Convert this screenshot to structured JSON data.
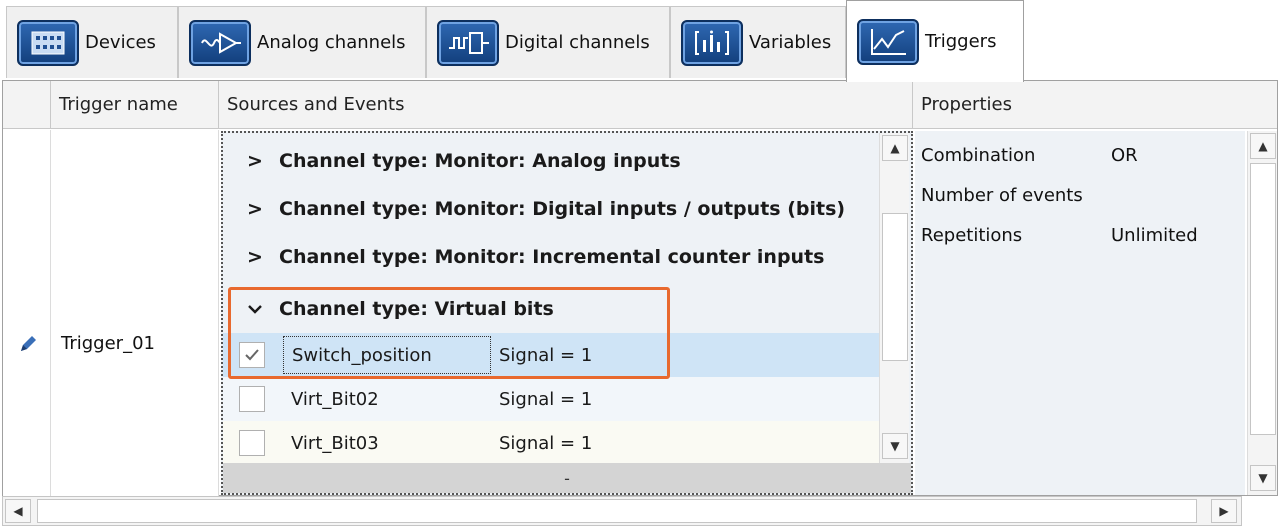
{
  "tabs": [
    {
      "label": "Devices",
      "icon": "devices-icon",
      "active": false
    },
    {
      "label": "Analog channels",
      "icon": "analog-channels-icon",
      "active": false
    },
    {
      "label": "Digital channels",
      "icon": "digital-channels-icon",
      "active": false
    },
    {
      "label": "Variables",
      "icon": "variables-icon",
      "active": false
    },
    {
      "label": "Triggers",
      "icon": "triggers-icon",
      "active": true
    }
  ],
  "grid": {
    "columns": [
      "Trigger name",
      "Sources and Events",
      "Properties"
    ],
    "trigger_name": "Trigger_01"
  },
  "sources": {
    "groups": [
      {
        "label": "Channel type: Monitor: Analog inputs",
        "expanded": false
      },
      {
        "label": "Channel type: Monitor: Digital inputs / outputs (bits)",
        "expanded": false
      },
      {
        "label": "Channel type: Monitor: Incremental counter inputs",
        "expanded": false
      },
      {
        "label": "Channel type: Virtual bits",
        "expanded": true
      }
    ],
    "items": [
      {
        "name": "Switch_position",
        "event": "Signal = 1",
        "checked": true
      },
      {
        "name": "Virt_Bit02",
        "event": "Signal = 1",
        "checked": false
      },
      {
        "name": "Virt_Bit03",
        "event": "Signal = 1",
        "checked": false
      }
    ],
    "footer": "-"
  },
  "properties": [
    {
      "key": "Combination",
      "value": "OR"
    },
    {
      "key": "Number of events",
      "value": ""
    },
    {
      "key": "Repetitions",
      "value": "Unlimited"
    }
  ],
  "colors": {
    "accent_highlight": "#e8692e",
    "selected_row": "#cfe4f6",
    "tab_icon_blue": "#1f4f92"
  }
}
